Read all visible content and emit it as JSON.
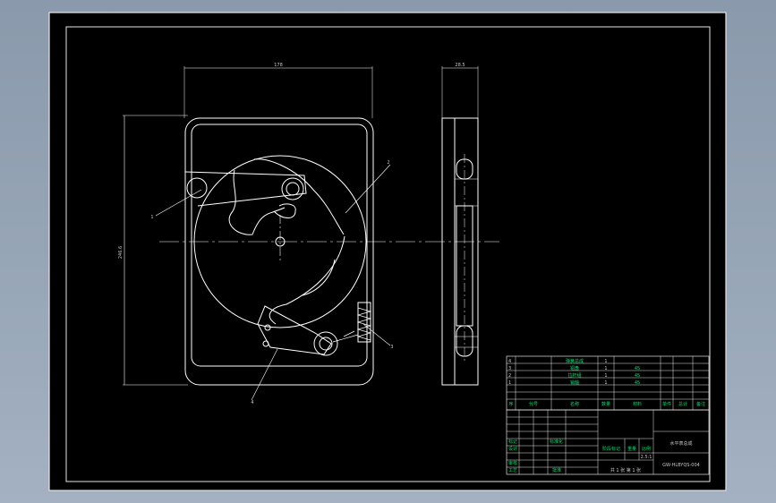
{
  "drawing": {
    "dims": {
      "width": "178",
      "height": "246.6",
      "thickness": "28.5"
    },
    "balloons": [
      "1",
      "2",
      "3",
      "4"
    ],
    "bom": [
      {
        "no": "4",
        "name": "弹簧总成",
        "qty": "1",
        "mat": ""
      },
      {
        "no": "3",
        "name": "铝盘",
        "qty": "1",
        "mat": "45"
      },
      {
        "no": "2",
        "name": "拉杆组",
        "qty": "1",
        "mat": "45"
      },
      {
        "no": "1",
        "name": "销轴",
        "qty": "1",
        "mat": "45"
      }
    ],
    "bom_header": [
      "序",
      "代号",
      "名称",
      "数量",
      "材料",
      "单件",
      "总计",
      "备注"
    ],
    "title_block": {
      "title": "水平表总成",
      "drawing_no": "GW-HLBYQS-004",
      "scale": "2.5:1",
      "sheets": "共 1 张  第 1 张",
      "stage_label": "阶段标记",
      "weight_label": "重量",
      "scale_label": "比例",
      "roles": [
        "标记",
        "设计",
        "审核",
        "工艺"
      ],
      "std": "标准化",
      "approve": "批准"
    }
  }
}
